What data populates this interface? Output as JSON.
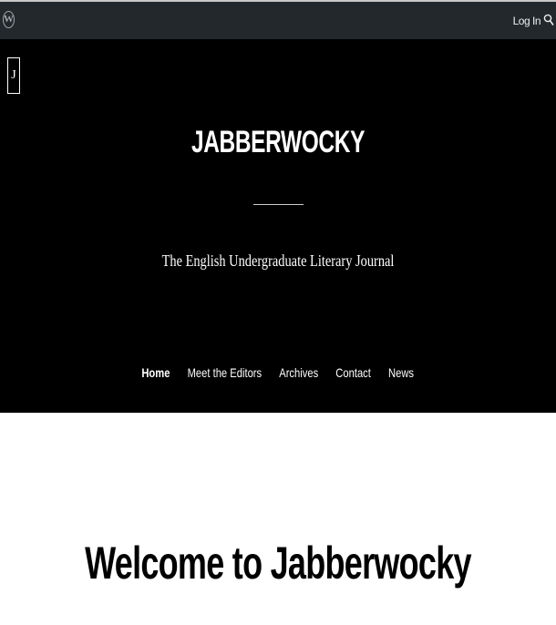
{
  "adminbar": {
    "logo_glyph": "W",
    "login_label": "Log In",
    "logo_icon": "wordpress-icon",
    "search_icon": "search-icon"
  },
  "header": {
    "site_icon_glyph": "J",
    "site_title": "JABBERWOCKY",
    "tagline": "The English Undergraduate Literary Journal",
    "background": "#000000",
    "text_color": "#ffffff"
  },
  "nav": {
    "items": [
      {
        "label": "Home",
        "current": true
      },
      {
        "label": "Meet the Editors",
        "current": false
      },
      {
        "label": "Archives",
        "current": false
      },
      {
        "label": "Contact",
        "current": false
      },
      {
        "label": "News",
        "current": false
      }
    ]
  },
  "main": {
    "page_title": "Welcome to Jabberwocky"
  }
}
